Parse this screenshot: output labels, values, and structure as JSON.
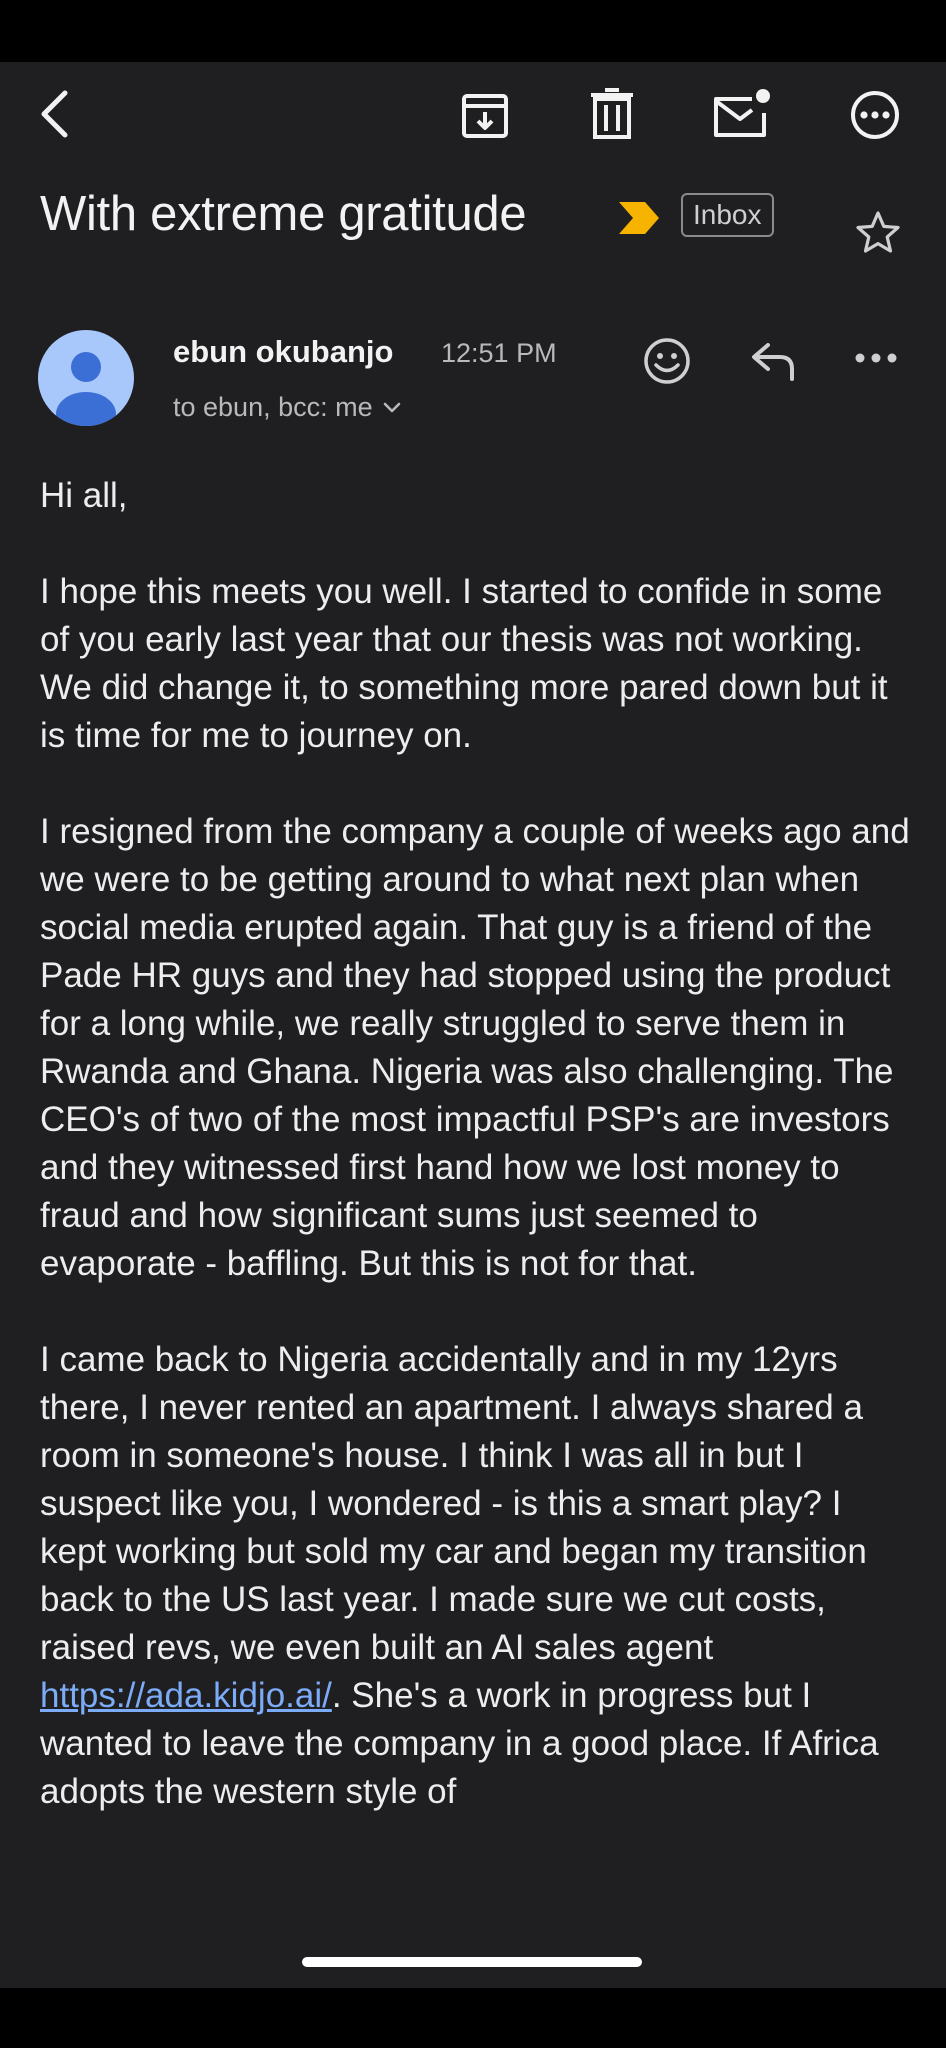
{
  "toolbar": {
    "back": "back-icon",
    "archive": "archive-icon",
    "delete": "trash-icon",
    "mark_unread": "mail-unread-icon",
    "more": "more-icon"
  },
  "email": {
    "subject": "With extreme gratitude",
    "label": "Inbox",
    "sender_name": "ebun okubanjo",
    "time": "12:51 PM",
    "recipients": "to ebun, bcc: me",
    "paragraphs": {
      "p1": "Hi all,",
      "p2": "I hope this meets you well. I started to confide in some of you early last year that our thesis was not working. We did change it, to something more pared down but it is time for me to journey on.",
      "p3": "I resigned from the company a couple of weeks ago and we were to be getting around to what next plan when social media erupted again. That guy is a friend of the Pade HR guys and they had stopped using the product for a long while, we really struggled to serve them in Rwanda and Ghana. Nigeria was also challenging. The CEO's of two of the most impactful PSP's are investors and they witnessed first hand how we lost money to fraud and how significant sums just seemed to evaporate - baffling. But this is not for that.",
      "p4_before": "I came back to Nigeria accidentally and in my 12yrs there, I never rented an apartment. I always shared a room in someone's house. I think I was all in but I suspect like you, I wondered - is this a smart play? I kept working but sold my car and began my transition back to the US last year. I made sure we cut costs, raised revs, we even built an AI sales agent ",
      "p4_link": "https://ada.kidjo.ai/",
      "p4_after": ". She's a work in progress but I wanted to leave the company in a good place. If Africa adopts the western style of"
    }
  },
  "colors": {
    "background": "#1f1f21",
    "importance_marker": "#f6b400",
    "link": "#7cacf8",
    "avatar": "#a8c7fa"
  }
}
